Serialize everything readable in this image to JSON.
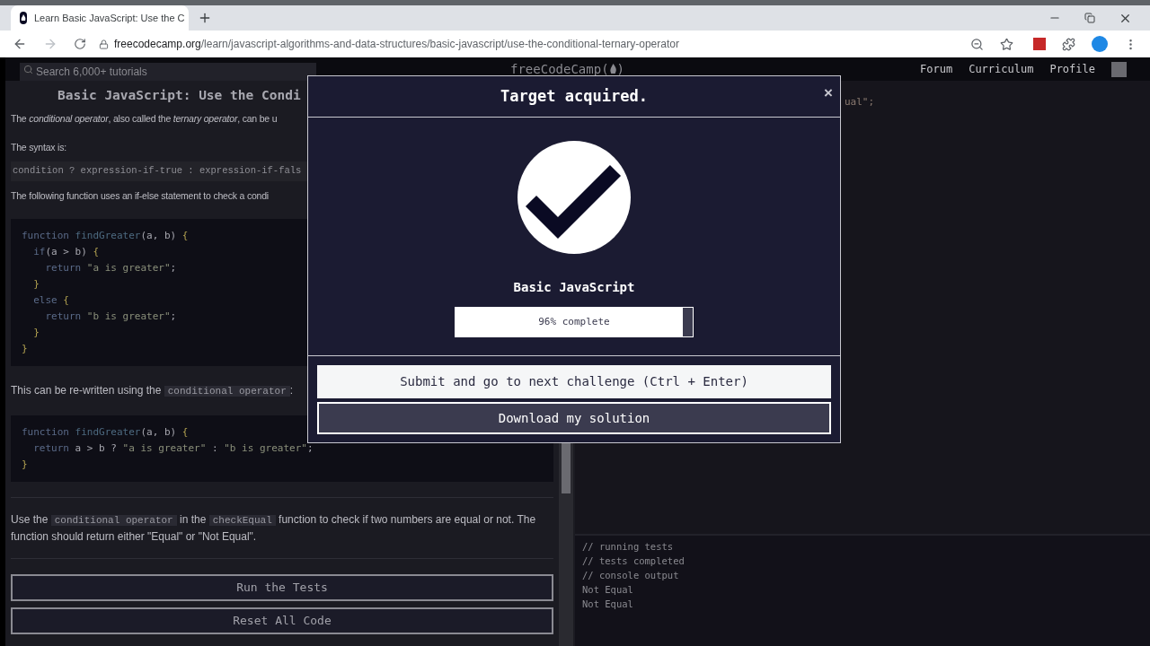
{
  "browser": {
    "tab": {
      "title": "Learn Basic JavaScript: Use the C",
      "selected": true
    },
    "url_host": "freecodecamp.org",
    "url_path": "/learn/javascript-algorithms-and-data-structures/basic-javascript/use-the-conditional-ternary-operator"
  },
  "navbar": {
    "search": {
      "placeholder": "Search 6,000+ tutorials"
    },
    "logo_before": "freeCodeCamp(",
    "logo_after": ")",
    "links": [
      "Forum",
      "Curriculum",
      "Profile"
    ]
  },
  "lesson": {
    "title": "Basic JavaScript: Use the Condi",
    "blocks": [
      {
        "kind": "paragraph",
        "segments": [
          {
            "kind": "text",
            "text": "The *conditional operator*, also called the *ternary operator*, can be u"
          }
        ]
      },
      {
        "kind": "paragraph",
        "segments": [
          {
            "kind": "text",
            "text": "The syntax is:"
          }
        ]
      },
      {
        "kind": "code_line",
        "text": "condition ? expression-if-true : expression-if-fals"
      },
      {
        "kind": "paragraph",
        "segments": [
          {
            "kind": "text",
            "text": "The following function uses an if-else statement to check a condi"
          }
        ]
      },
      {
        "kind": "code_block",
        "lines": [
          [
            {
              "kind": "keyword",
              "text": "function "
            },
            {
              "kind": "func",
              "text": "findGreater"
            },
            {
              "kind": "plain",
              "text": "(a, b) "
            },
            {
              "kind": "brace",
              "text": "{"
            }
          ],
          [
            {
              "kind": "keyword",
              "text": "  if"
            },
            {
              "kind": "plain",
              "text": "(a > b) "
            },
            {
              "kind": "brace",
              "text": "{"
            }
          ],
          [
            {
              "kind": "keyword",
              "text": "    return "
            },
            {
              "kind": "string",
              "text": "\"a is greater\""
            },
            {
              "kind": "plain",
              "text": ";"
            }
          ],
          [
            {
              "kind": "brace",
              "text": "  }"
            }
          ],
          [
            {
              "kind": "keyword",
              "text": "  else "
            },
            {
              "kind": "brace",
              "text": "{"
            }
          ],
          [
            {
              "kind": "keyword",
              "text": "    return "
            },
            {
              "kind": "string",
              "text": "\"b is greater\""
            },
            {
              "kind": "plain",
              "text": ";"
            }
          ],
          [
            {
              "kind": "brace",
              "text": "  }"
            }
          ],
          [
            {
              "kind": "brace",
              "text": "}"
            }
          ]
        ]
      },
      {
        "kind": "paragraph",
        "segments": [
          {
            "kind": "text",
            "text": "This can be re-written using the "
          },
          {
            "kind": "code",
            "text": "conditional operator"
          },
          {
            "kind": "text",
            "text": ":"
          }
        ]
      },
      {
        "kind": "code_block",
        "lines": [
          [
            {
              "kind": "keyword",
              "text": "function "
            },
            {
              "kind": "func",
              "text": "findGreater"
            },
            {
              "kind": "plain",
              "text": "(a, b) "
            },
            {
              "kind": "brace",
              "text": "{"
            }
          ],
          [
            {
              "kind": "keyword",
              "text": "  return "
            },
            {
              "kind": "plain",
              "text": "a > b ? "
            },
            {
              "kind": "string",
              "text": "\"a is greater\""
            },
            {
              "kind": "plain",
              "text": " : "
            },
            {
              "kind": "string",
              "text": "\"b is greater\""
            },
            {
              "kind": "plain",
              "text": ";"
            }
          ],
          [
            {
              "kind": "brace",
              "text": "}"
            }
          ]
        ]
      },
      {
        "kind": "divider"
      },
      {
        "kind": "paragraph",
        "segments": [
          {
            "kind": "text",
            "text": "Use the "
          },
          {
            "kind": "code",
            "text": "conditional operator"
          },
          {
            "kind": "text",
            "text": " in the "
          },
          {
            "kind": "code",
            "text": "checkEqual"
          },
          {
            "kind": "text",
            "text": " function to check if two numbers are equal or not. The function should return either \"Equal\" or \"Not Equal\"."
          }
        ]
      },
      {
        "kind": "divider"
      }
    ],
    "buttons": [
      "Run the Tests",
      "Reset All Code"
    ]
  },
  "editor": {
    "lines": [
      "ual\";"
    ]
  },
  "console": {
    "lines": [
      "// running tests",
      "// tests completed",
      "// console output",
      "Not Equal",
      "Not Equal"
    ]
  },
  "modal": {
    "title": "Target acquired.",
    "close": "×",
    "block": "Basic JavaScript",
    "progress": {
      "level": 0.96,
      "label": "96% complete"
    },
    "buttons": [
      {
        "kind": "primary",
        "label": "Submit and go to next challenge (Ctrl + Enter)"
      },
      {
        "kind": "secondary",
        "label": "Download my solution"
      }
    ]
  }
}
